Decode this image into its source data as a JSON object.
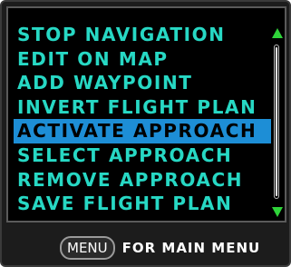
{
  "menu": {
    "items": [
      {
        "label": "Stop Navigation"
      },
      {
        "label": "Edit on Map"
      },
      {
        "label": "Add Waypoint"
      },
      {
        "label": "Invert Flight Plan"
      },
      {
        "label": "Activate Approach"
      },
      {
        "label": "Select Approach"
      },
      {
        "label": "Remove Approach"
      },
      {
        "label": "Save Flight Plan"
      }
    ],
    "selected_index": 4,
    "scroll_up_icon": "arrow-up-icon",
    "scroll_down_icon": "arrow-down-icon"
  },
  "footer": {
    "key_label": "MENU",
    "text": "for Main Menu"
  },
  "colors": {
    "menu_text": "#27d8c4",
    "highlight": "#1d8ed6",
    "scroll_arrow": "#2fd43a"
  }
}
